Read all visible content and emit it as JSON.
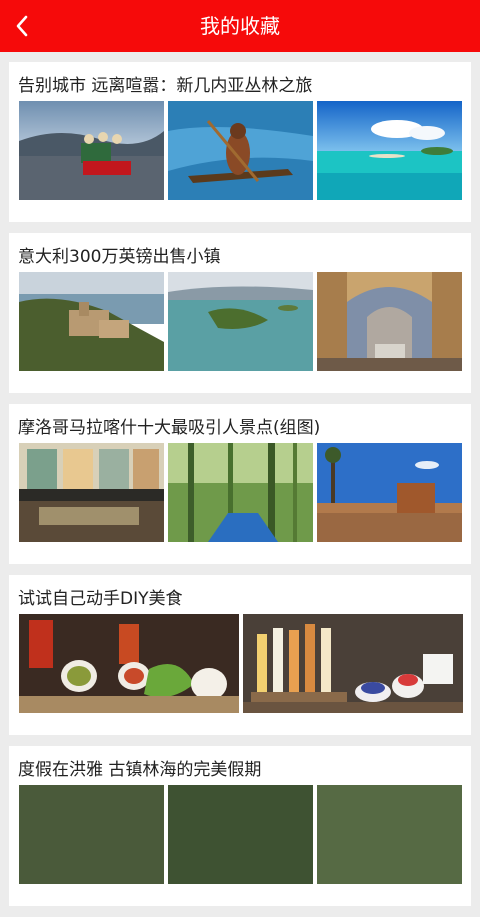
{
  "header": {
    "title": "我的收藏",
    "back_icon": "chevron-left-icon",
    "bg_color": "#f60a0a"
  },
  "favorites": [
    {
      "title": "告别城市 远离喧嚣：新几内亚丛林之旅"
    },
    {
      "title": "意大利300万英镑出售小镇"
    },
    {
      "title": "摩洛哥马拉喀什十大最吸引人景点(组图)"
    },
    {
      "title": "试试自己动手DIY美食"
    },
    {
      "title": "度假在洪雅 古镇林海的完美假期"
    }
  ]
}
